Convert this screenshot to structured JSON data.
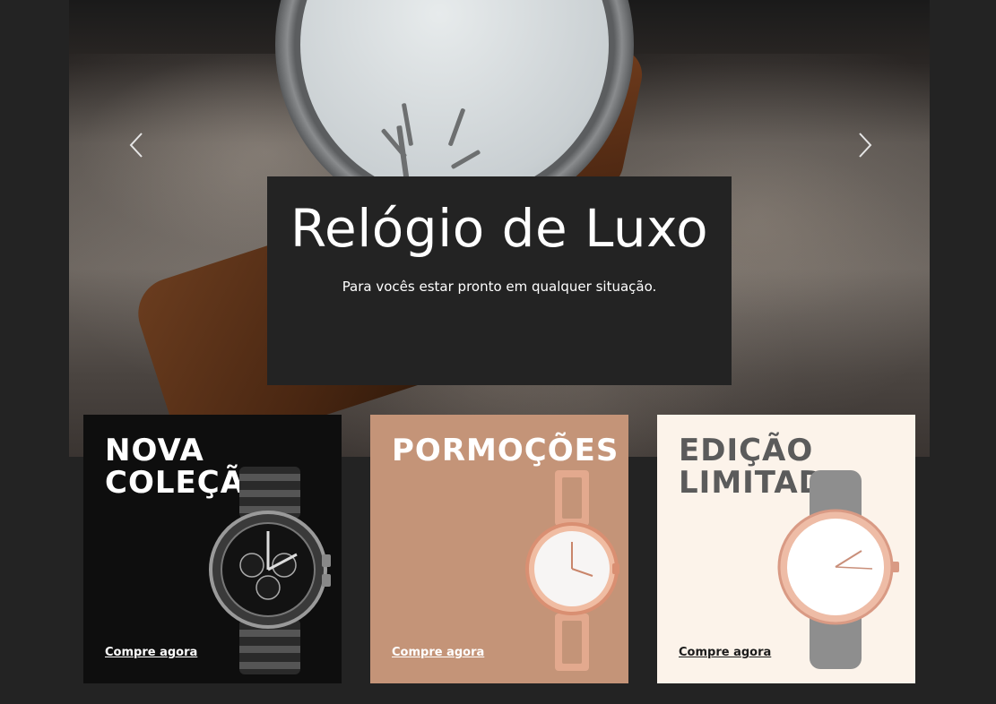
{
  "hero": {
    "title": "Relógio de Luxo",
    "subtitle": "Para vocês estar pronto em qualquer situação.",
    "prev_icon": "chevron-left-icon",
    "next_icon": "chevron-right-icon"
  },
  "cards": [
    {
      "title": "NOVA\nCOLEÇÃO",
      "cta": "Compre agora",
      "background": "#0e0e0e"
    },
    {
      "title": "PORMOÇÕES",
      "cta": "Compre agora",
      "background": "#c49478"
    },
    {
      "title": "EDIÇÃO\nLIMITADA",
      "cta": "Compre agora",
      "background": "#fcf3ea"
    }
  ],
  "colors": {
    "page_background": "#232323",
    "caption_background": "#232323",
    "text_light": "#ffffff"
  }
}
